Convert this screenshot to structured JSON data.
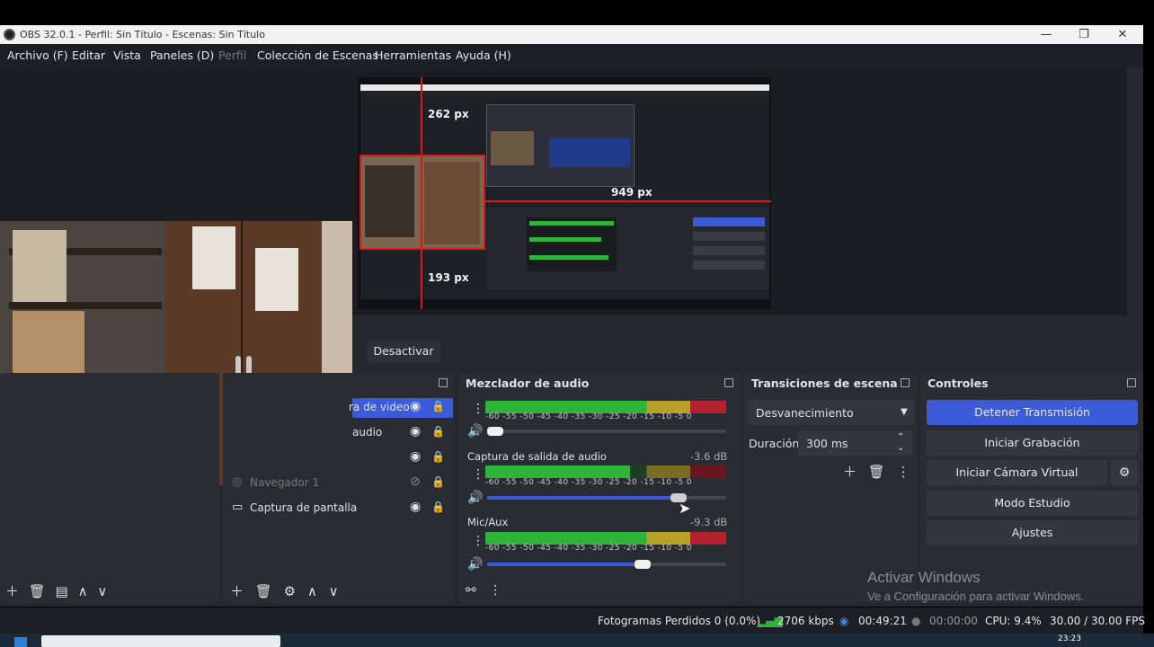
{
  "window": {
    "title": "OBS 32.0.1 - Perfil: Sin Título - Escenas: Sin Título",
    "controls": {
      "minimize": "—",
      "restore": "❐",
      "close": "✕"
    }
  },
  "menu": {
    "items": [
      "Archivo (F)",
      "Editar",
      "Vista",
      "Paneles (D)",
      "Perfil",
      "Colección de Escenas",
      "Herramientas",
      "Ayuda (H)"
    ]
  },
  "preview": {
    "guide_top": "262 px",
    "guide_right": "949 px",
    "guide_bottom": "193 px"
  },
  "scene_bar": {
    "deactivate_label": "Desactivar"
  },
  "sources": {
    "items": [
      {
        "label": "ra de video"
      },
      {
        "label": "audio"
      },
      {
        "label": ""
      },
      {
        "label": "Navegador 1"
      },
      {
        "label": "Captura de pantalla"
      }
    ]
  },
  "mixer": {
    "title": "Mezclador de audio",
    "ticks": "-60 -55 -50 -45 -40 -35 -30 -25 -20 -15 -10 -5 0",
    "channels": [
      {
        "name": "",
        "db": "",
        "level": 0.9,
        "volume": 0.04
      },
      {
        "name": "Captura de salida de audio",
        "db": "-3.6 dB",
        "level": 0.74,
        "volume": 0.82
      },
      {
        "name": "Mic/Aux",
        "db": "-9.3 dB",
        "level": 0.66,
        "volume": 0.66
      }
    ]
  },
  "transitions": {
    "title": "Transiciones de escena",
    "selected": "Desvanecimiento",
    "duration_label": "Duración",
    "duration_value": "300 ms"
  },
  "controls": {
    "title": "Controles",
    "stop_stream": "Detener Transmisión",
    "start_recording": "Iniciar Grabación",
    "start_virtual_cam": "Iniciar Cámara Virtual",
    "studio_mode": "Modo Estudio",
    "settings": "Ajustes"
  },
  "watermark": {
    "line1": "Activar Windows",
    "line2": "Ve a Configuración para activar Windows."
  },
  "status": {
    "dropped_frames": "Fotogramas Perdidos 0 (0.0%)",
    "bitrate": "2706 kbps",
    "stream_time": "00:49:21",
    "record_time": "00:00:00",
    "cpu": "CPU: 9.4%",
    "fps": "30.00 / 30.00 FPS"
  },
  "taskbar": {
    "clock": "23:23"
  },
  "colors": {
    "accent": "#3c5bd8",
    "meter_green": "#2fb43a",
    "meter_yellow": "#b7a12a",
    "meter_red": "#b3202e"
  }
}
